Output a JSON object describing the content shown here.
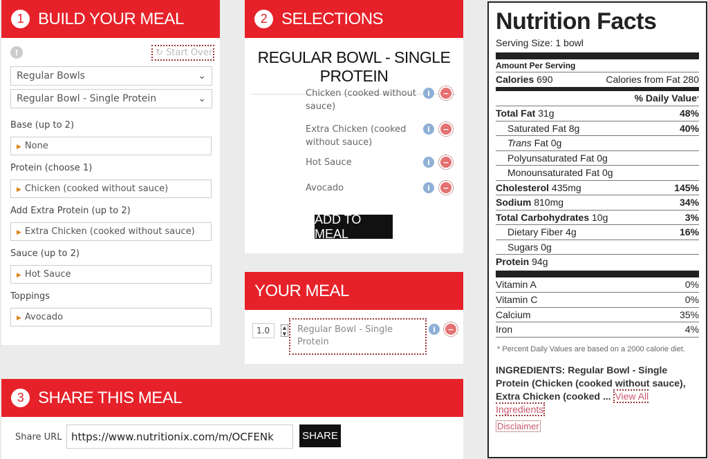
{
  "build": {
    "step": "1",
    "title": "BUILD YOUR MEAL",
    "start_over": "Start Over",
    "category": "Regular Bowls",
    "item": "Regular Bowl - Single Protein",
    "groups": [
      {
        "label": "Base (up to 2)",
        "value": "None"
      },
      {
        "label": "Protein (choose 1)",
        "value": "Chicken (cooked without sauce)"
      },
      {
        "label": "Add Extra Protein (up to 2)",
        "value": "Extra Chicken (cooked without sauce)"
      },
      {
        "label": "Sauce (up to 2)",
        "value": "Hot Sauce"
      },
      {
        "label": "Toppings",
        "value": "Avocado"
      }
    ]
  },
  "selections": {
    "step": "2",
    "title": "SELECTIONS",
    "item_title": "REGULAR BOWL - SINGLE PROTEIN",
    "items": [
      "Chicken (cooked without sauce)",
      "Extra Chicken (cooked without sauce)",
      "Hot Sauce",
      "Avocado"
    ],
    "add_button": "ADD TO MEAL"
  },
  "meal": {
    "title": "YOUR MEAL",
    "qty": "1.0",
    "item": "Regular Bowl - Single Protein"
  },
  "share": {
    "step": "3",
    "title": "SHARE THIS MEAL",
    "label": "Share URL",
    "url": "https://www.nutritionix.com/m/OCFENk",
    "button": "SHARE"
  },
  "nutrition": {
    "title": "Nutrition Facts",
    "serving": "Serving Size: 1 bowl",
    "amount_per": "Amount Per Serving",
    "calories_label": "Calories",
    "calories": "690",
    "cal_fat_label": "Calories from Fat",
    "cal_fat": "280",
    "dv_header": "% Daily Value",
    "rows": [
      {
        "label": "Total Fat",
        "value": "31g",
        "dv": "48%",
        "bold": true
      },
      {
        "label": "Saturated Fat",
        "value": "8g",
        "dv": "40%",
        "indent": true
      },
      {
        "label": "Trans",
        "suffix": " Fat",
        "value": "0g",
        "dv": "",
        "indent": true,
        "italic": true
      },
      {
        "label": "Polyunsaturated Fat",
        "value": "0g",
        "dv": "",
        "indent": true
      },
      {
        "label": "Monounsaturated Fat",
        "value": "0g",
        "dv": "",
        "indent": true
      },
      {
        "label": "Cholesterol",
        "value": "435mg",
        "dv": "145%",
        "bold": true
      },
      {
        "label": "Sodium",
        "value": "810mg",
        "dv": "34%",
        "bold": true
      },
      {
        "label": "Total Carbohydrates",
        "value": "10g",
        "dv": "3%",
        "bold": true
      },
      {
        "label": "Dietary Fiber",
        "value": "4g",
        "dv": "16%",
        "indent": true
      },
      {
        "label": "Sugars",
        "value": "0g",
        "dv": "",
        "indent": true
      },
      {
        "label": "Protein",
        "value": "94g",
        "dv": "",
        "bold": true
      }
    ],
    "vitamins": [
      {
        "label": "Vitamin A",
        "dv": "0%"
      },
      {
        "label": "Vitamin C",
        "dv": "0%"
      },
      {
        "label": "Calcium",
        "dv": "35%"
      },
      {
        "label": "Iron",
        "dv": "4%"
      }
    ],
    "footnote": "* Percent Daily Values are based on a 2000 calorie diet.",
    "ingredients": "INGREDIENTS: Regular Bowl - Single Protein (Chicken (cooked without sauce), Extra Chicken (cooked ...",
    "view_all": "View All Ingredients",
    "disclaimer": "Disclaimer"
  }
}
